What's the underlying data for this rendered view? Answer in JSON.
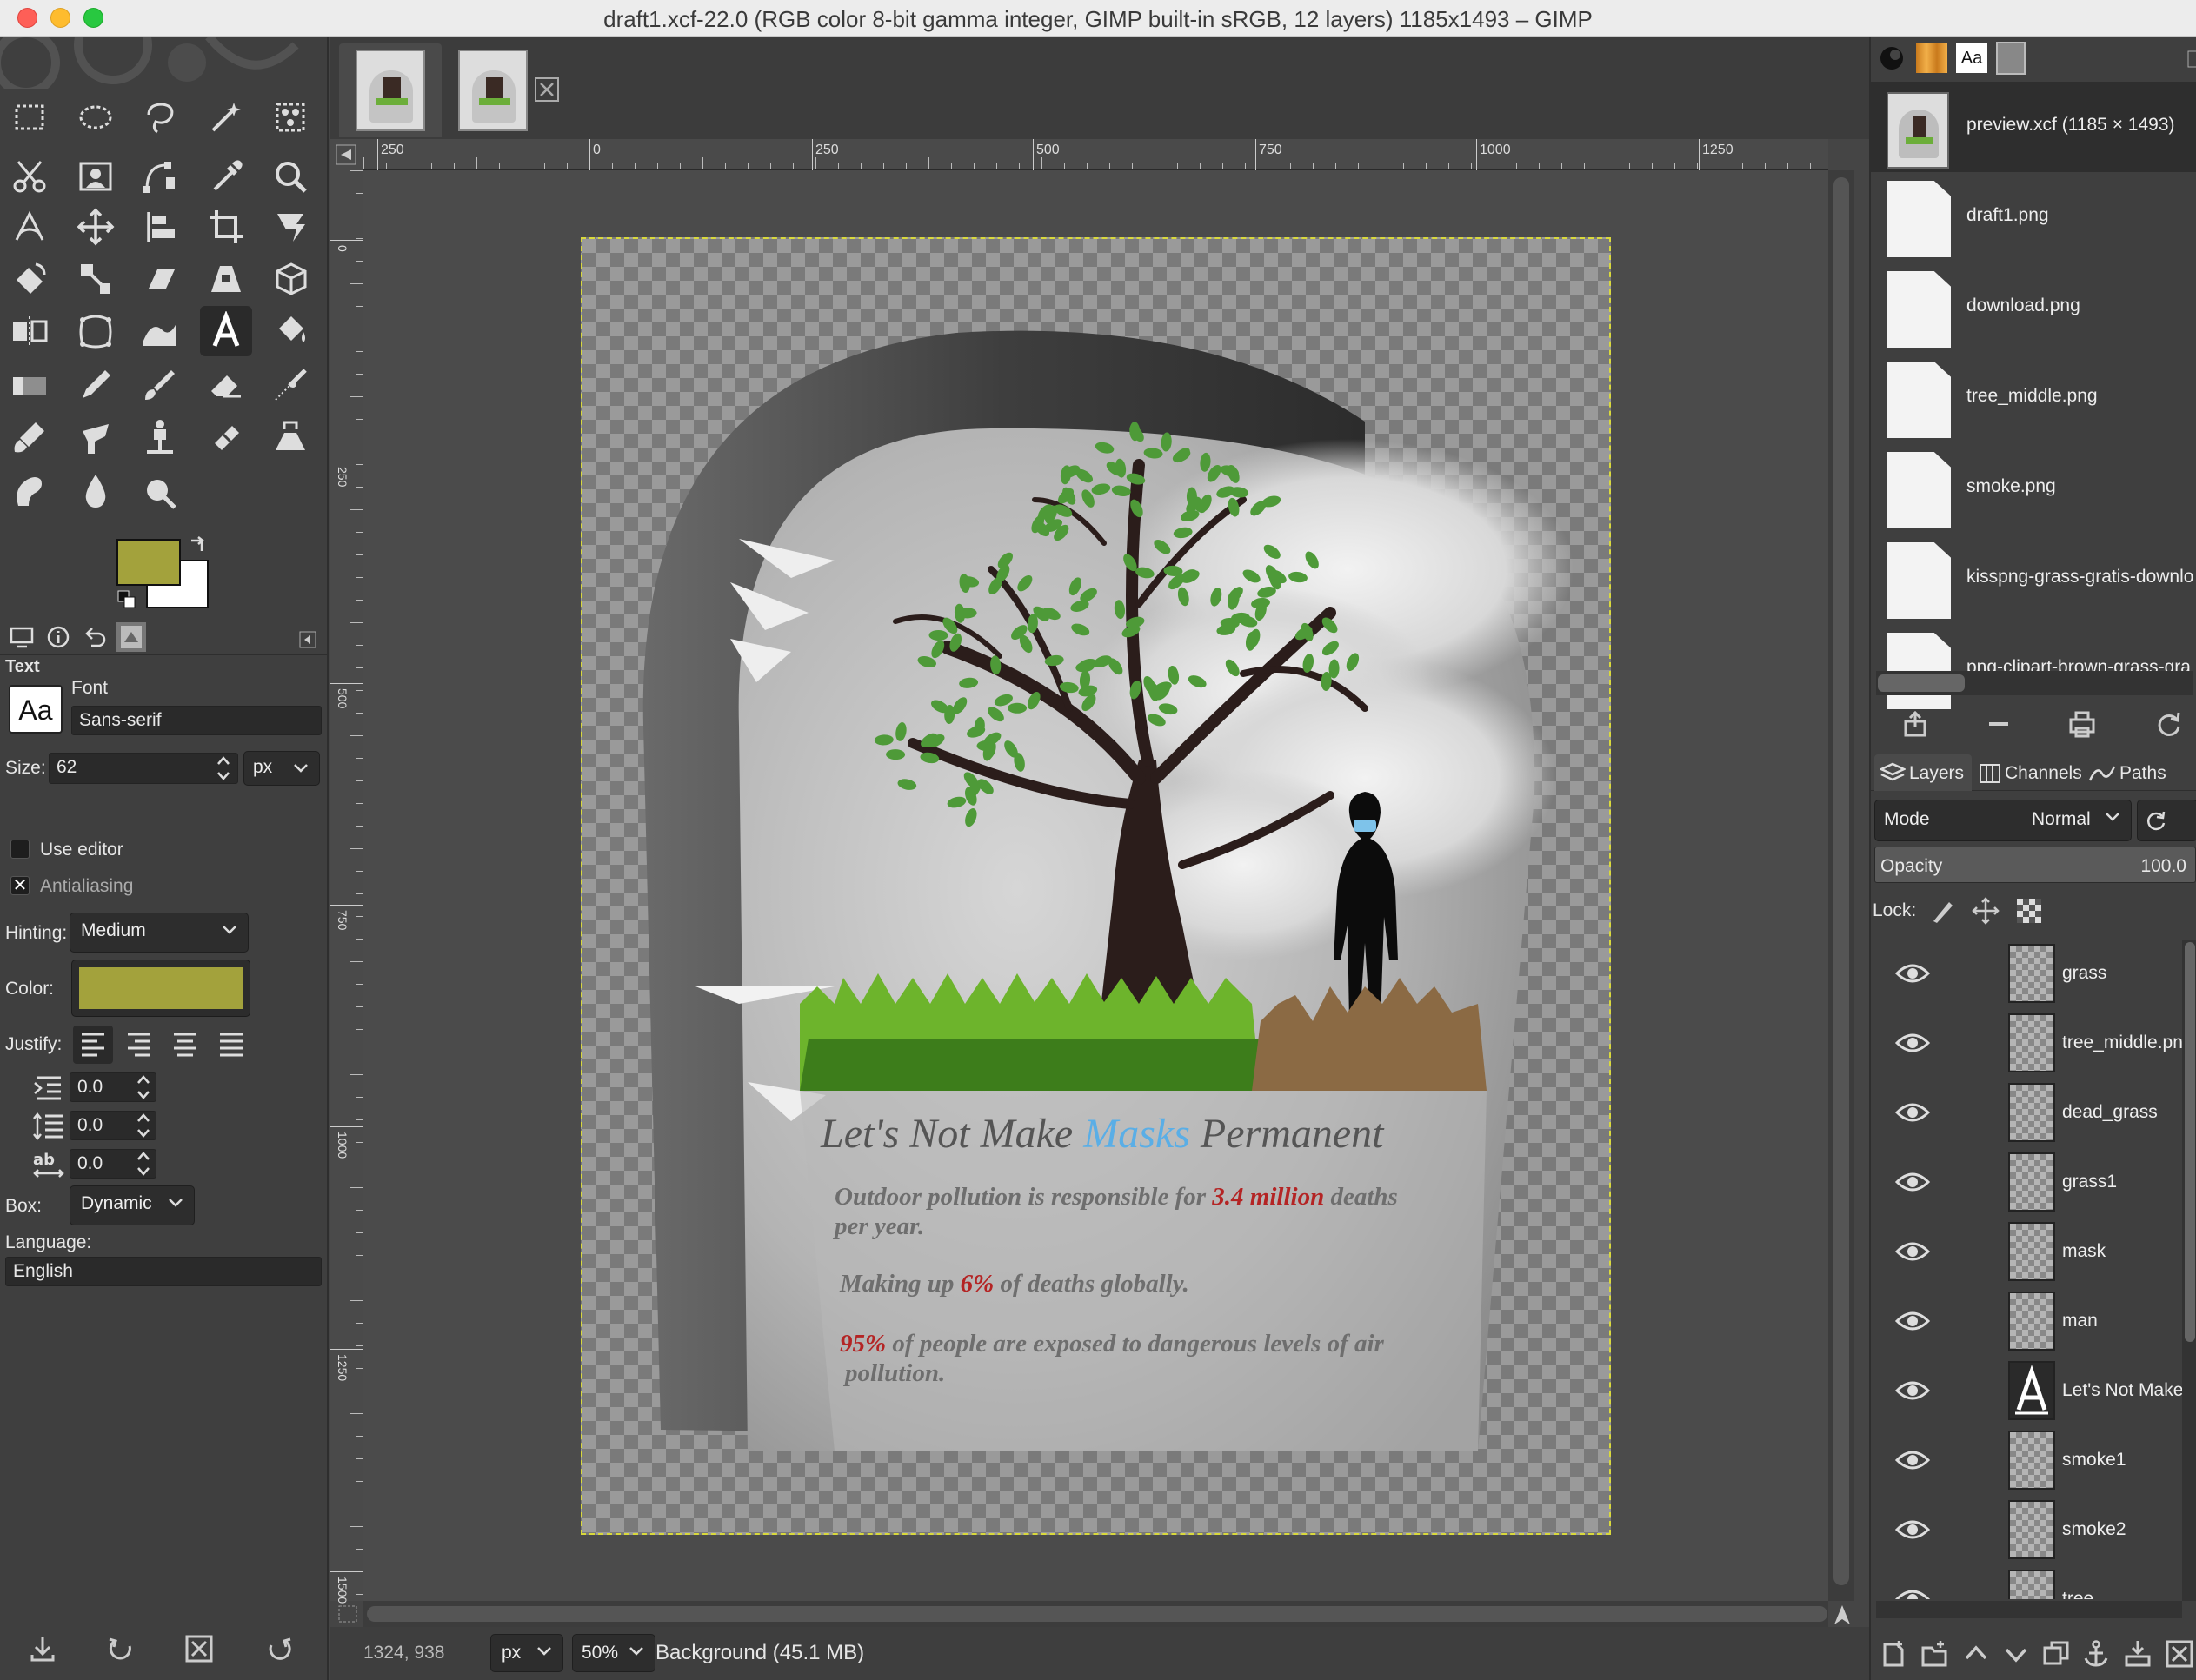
{
  "window": {
    "title": "draft1.xcf-22.0 (RGB color 8-bit gamma integer, GIMP built-in sRGB, 12 layers) 1185x1493 – GIMP"
  },
  "colors": {
    "foreground": "#a3a23c",
    "background": "#ffffff",
    "text_color": "#a3a23c",
    "accent_blue": "#5aaee6",
    "accent_red": "#b42424"
  },
  "toolbox": {
    "tools": [
      "rect-select",
      "ellipse-select",
      "free-select",
      "fuzzy-select",
      "select-by-color",
      "scissors",
      "foreground-select",
      "paths",
      "color-picker",
      "zoom",
      "measure",
      "move",
      "align",
      "crop",
      "unified-transform",
      "rotate",
      "scale",
      "shear",
      "perspective",
      "3d-transform",
      "flip",
      "cage",
      "warp",
      "text",
      "bucket-fill",
      "gradient",
      "pencil",
      "paintbrush",
      "eraser",
      "airbrush",
      "ink",
      "mypaint",
      "clone",
      "heal",
      "perspective-clone",
      "smudge",
      "blur",
      "dodge"
    ],
    "active_tool": "text",
    "panel_heading": "Text",
    "font_label": "Font",
    "font_value": "Sans-serif",
    "font_preview": "Aa",
    "size_label": "Size:",
    "size_value": "62",
    "size_unit": "px",
    "use_editor_label": "Use editor",
    "use_editor_checked": false,
    "antialiasing_label": "Antialiasing",
    "antialiasing_checked": true,
    "hinting_label": "Hinting:",
    "hinting_value": "Medium",
    "color_label": "Color:",
    "justify_label": "Justify:",
    "indent_value": "0.0",
    "line_spacing_value": "0.0",
    "letter_spacing_value": "0.0",
    "box_label": "Box:",
    "box_value": "Dynamic",
    "language_label": "Language:",
    "language_value": "English"
  },
  "image_tabs": [
    {
      "name": "preview thumbnail",
      "active": true
    },
    {
      "name": "draft thumbnail",
      "active": false
    }
  ],
  "rulers": {
    "top": [
      "250",
      "0",
      "250",
      "500",
      "750",
      "1000",
      "1250"
    ],
    "left": [
      "0",
      "250",
      "500",
      "750",
      "1000",
      "1250",
      "1500"
    ]
  },
  "poster": {
    "title_part1": "Let's Not Make ",
    "title_highlight": "Masks",
    "title_part2": " Permanent",
    "line1_a": "Outdoor pollution is responsible for ",
    "line1_highlight": "3.4 million",
    "line1_b": " deaths",
    "line1_c": "per year.",
    "line2_a": "Making up ",
    "line2_highlight": "6%",
    "line2_b": " of deaths globally.",
    "line3_highlight": "95%",
    "line3_a": " of people are exposed to dangerous levels of air",
    "line3_b": "pollution."
  },
  "statusbar": {
    "coords": "1324, 938",
    "unit": "px",
    "zoom": "50%",
    "info": "Background (45.1 MB)"
  },
  "images_dock": {
    "items": [
      {
        "name": "preview.xcf (1185 × 1493)",
        "selected": true
      },
      {
        "name": "draft1.png",
        "selected": false
      },
      {
        "name": "download.png",
        "selected": false
      },
      {
        "name": "tree_middle.png",
        "selected": false
      },
      {
        "name": "smoke.png",
        "selected": false
      },
      {
        "name": "kisspng-grass-gratis-downlo",
        "selected": false
      },
      {
        "name": "png-clipart-brown-grass-gra",
        "selected": false
      }
    ]
  },
  "layers_dock": {
    "tabs": [
      "Layers",
      "Channels",
      "Paths"
    ],
    "mode_label": "Mode",
    "mode_value": "Normal",
    "opacity_label": "Opacity",
    "opacity_value": "100.0",
    "lock_label": "Lock:",
    "layers": [
      {
        "name": "grass",
        "visible": true,
        "text_layer": false
      },
      {
        "name": "tree_middle.png",
        "visible": true,
        "text_layer": false
      },
      {
        "name": "dead_grass",
        "visible": true,
        "text_layer": false
      },
      {
        "name": "grass1",
        "visible": true,
        "text_layer": false
      },
      {
        "name": "mask",
        "visible": true,
        "text_layer": false
      },
      {
        "name": "man",
        "visible": true,
        "text_layer": false
      },
      {
        "name": "Let's Not Make",
        "visible": true,
        "text_layer": true
      },
      {
        "name": "smoke1",
        "visible": true,
        "text_layer": false
      },
      {
        "name": "smoke2",
        "visible": true,
        "text_layer": false
      },
      {
        "name": "tree",
        "visible": true,
        "text_layer": false
      }
    ]
  }
}
